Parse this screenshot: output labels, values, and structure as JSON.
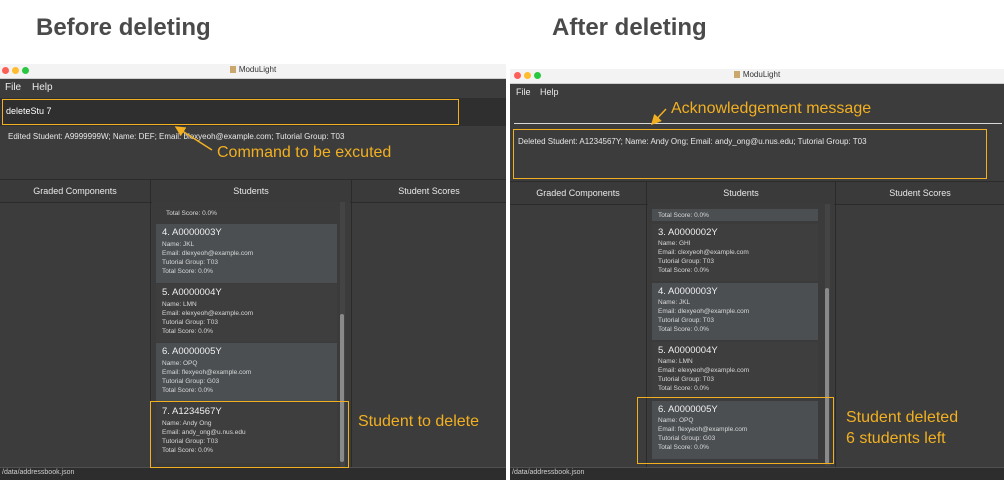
{
  "headings": {
    "before": "Before deleting",
    "after": "After deleting"
  },
  "app": {
    "title": "ModuLight",
    "menu": [
      "File",
      "Help"
    ]
  },
  "columns": [
    "Graded Components",
    "Students",
    "Student Scores"
  ],
  "status_path": "/data/addressbook.json",
  "accent_color": "#f2b021",
  "before": {
    "command": "deleteStu 7",
    "result": "Edited Student: A9999999W; Name: DEF; Email: blexyeoh@example.com; Tutorial Group: T03",
    "top_partial": "Total Score: 0.0%",
    "cards": [
      {
        "num": "4.  A0000003Y",
        "name": "Name: JKL",
        "email": "Email: dlexyeoh@example.com",
        "group": "Tutorial Group: T03",
        "score": "Total Score: 0.0%"
      },
      {
        "num": "5.  A0000004Y",
        "name": "Name: LMN",
        "email": "Email: elexyeoh@example.com",
        "group": "Tutorial Group: T03",
        "score": "Total Score: 0.0%"
      },
      {
        "num": "6.  A0000005Y",
        "name": "Name: OPQ",
        "email": "Email: flexyeoh@example.com",
        "group": "Tutorial Group: G03",
        "score": "Total Score: 0.0%"
      },
      {
        "num": "7.  A1234567Y",
        "name": "Name: Andy Ong",
        "email": "Email: andy_ong@u.nus.edu",
        "group": "Tutorial Group: T03",
        "score": "Total Score: 0.0%"
      }
    ],
    "annotations": {
      "command": "Command to be excuted",
      "delete": "Student to delete"
    }
  },
  "after": {
    "result": "Deleted Student: A1234567Y; Name: Andy Ong; Email: andy_ong@u.nus.edu; Tutorial Group: T03",
    "top_partial": "Total Score: 0.0%",
    "cards": [
      {
        "num": "3.  A0000002Y",
        "name": "Name: GHI",
        "email": "Email: clexyeoh@example.com",
        "group": "Tutorial Group: T03",
        "score": "Total Score: 0.0%"
      },
      {
        "num": "4.  A0000003Y",
        "name": "Name: JKL",
        "email": "Email: dlexyeoh@example.com",
        "group": "Tutorial Group: T03",
        "score": "Total Score: 0.0%"
      },
      {
        "num": "5.  A0000004Y",
        "name": "Name: LMN",
        "email": "Email: elexyeoh@example.com",
        "group": "Tutorial Group: T03",
        "score": "Total Score: 0.0%"
      },
      {
        "num": "6.  A0000005Y",
        "name": "Name: OPQ",
        "email": "Email: flexyeoh@example.com",
        "group": "Tutorial Group: G03",
        "score": "Total Score: 0.0%"
      }
    ],
    "annotations": {
      "ack": "Acknowledgement message",
      "deleted_1": "Student deleted",
      "deleted_2": "6 students left"
    }
  }
}
